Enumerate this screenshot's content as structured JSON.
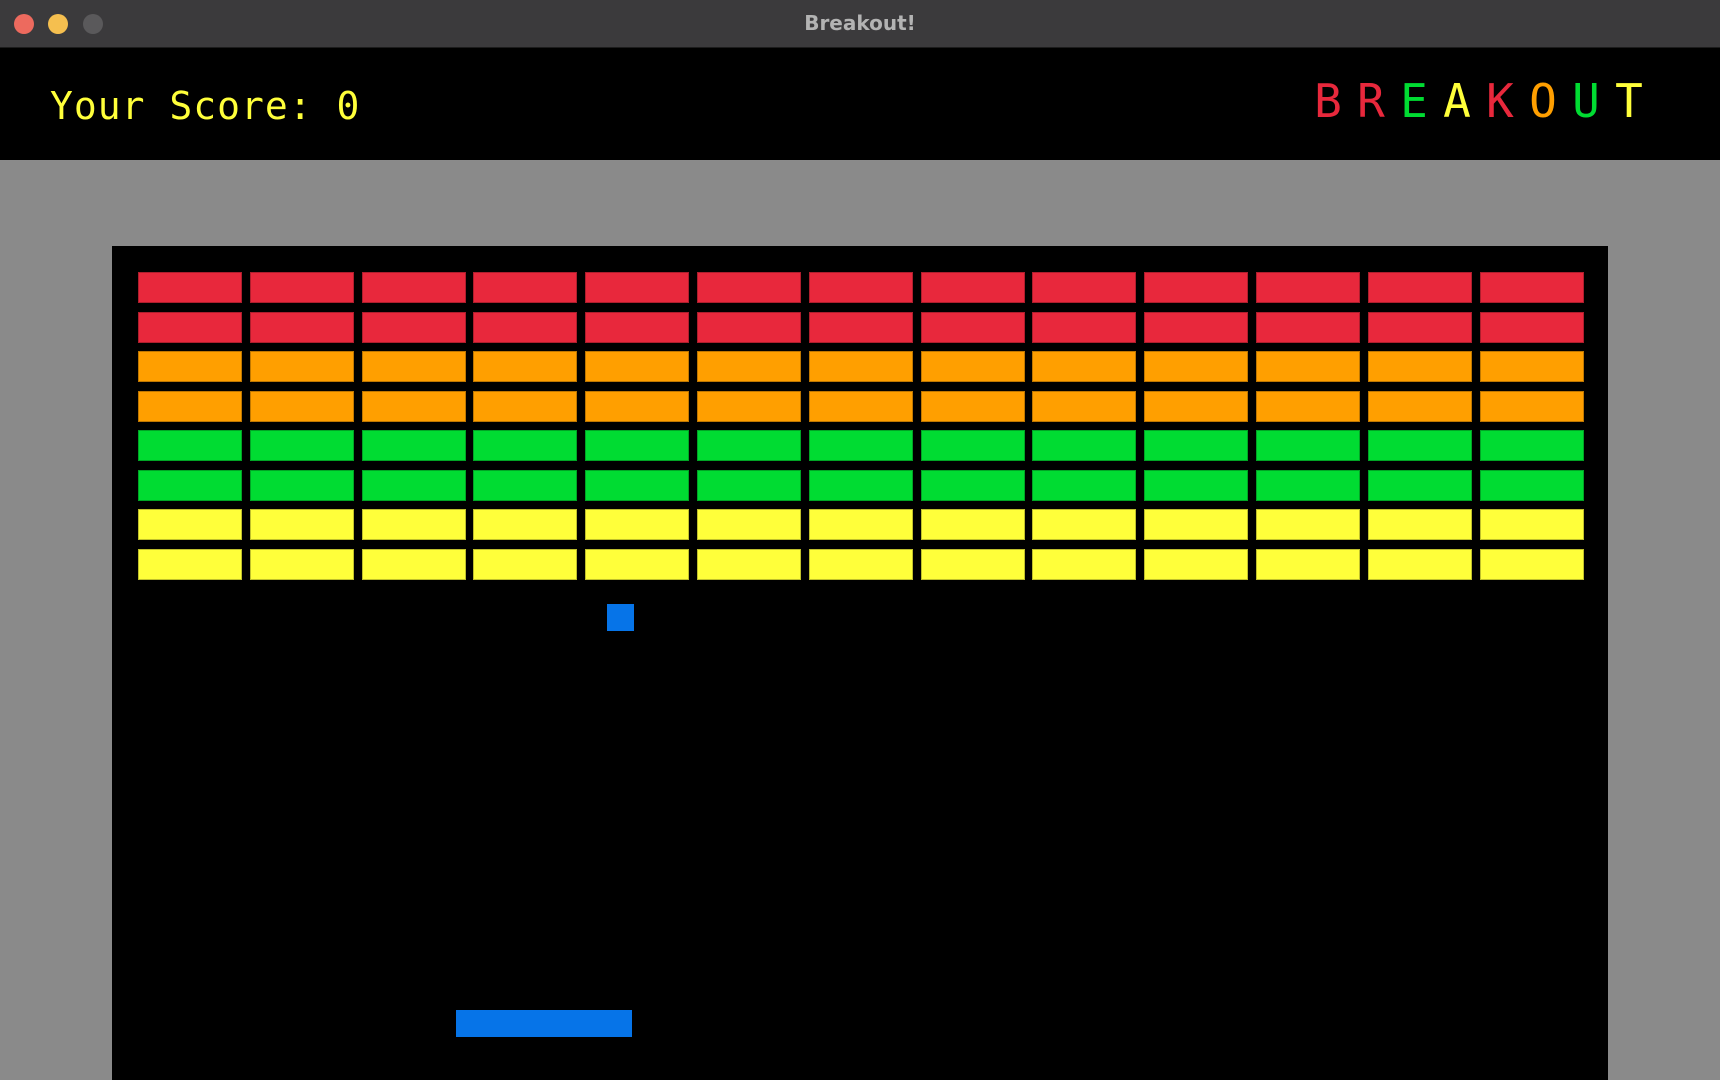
{
  "window": {
    "title": "Breakout!"
  },
  "header": {
    "score_label": "Your Score: 0",
    "logo_letters": [
      {
        "char": "B",
        "color": "#e8283c"
      },
      {
        "char": "R",
        "color": "#e8283c"
      },
      {
        "char": "E",
        "color": "#00dc32"
      },
      {
        "char": "A",
        "color": "#ffff3a"
      },
      {
        "char": "K",
        "color": "#e8283c"
      },
      {
        "char": "O",
        "color": "#ff9f00"
      },
      {
        "char": "U",
        "color": "#00dc32"
      },
      {
        "char": "T",
        "color": "#ffff3a"
      }
    ]
  },
  "board": {
    "columns": 13,
    "row_colors": [
      "#e8283c",
      "#e8283c",
      "#ff9f00",
      "#ff9f00",
      "#00dc32",
      "#00dc32",
      "#ffff3a",
      "#ffff3a"
    ],
    "ball_color": "#0674e8",
    "paddle_color": "#0674e8"
  }
}
